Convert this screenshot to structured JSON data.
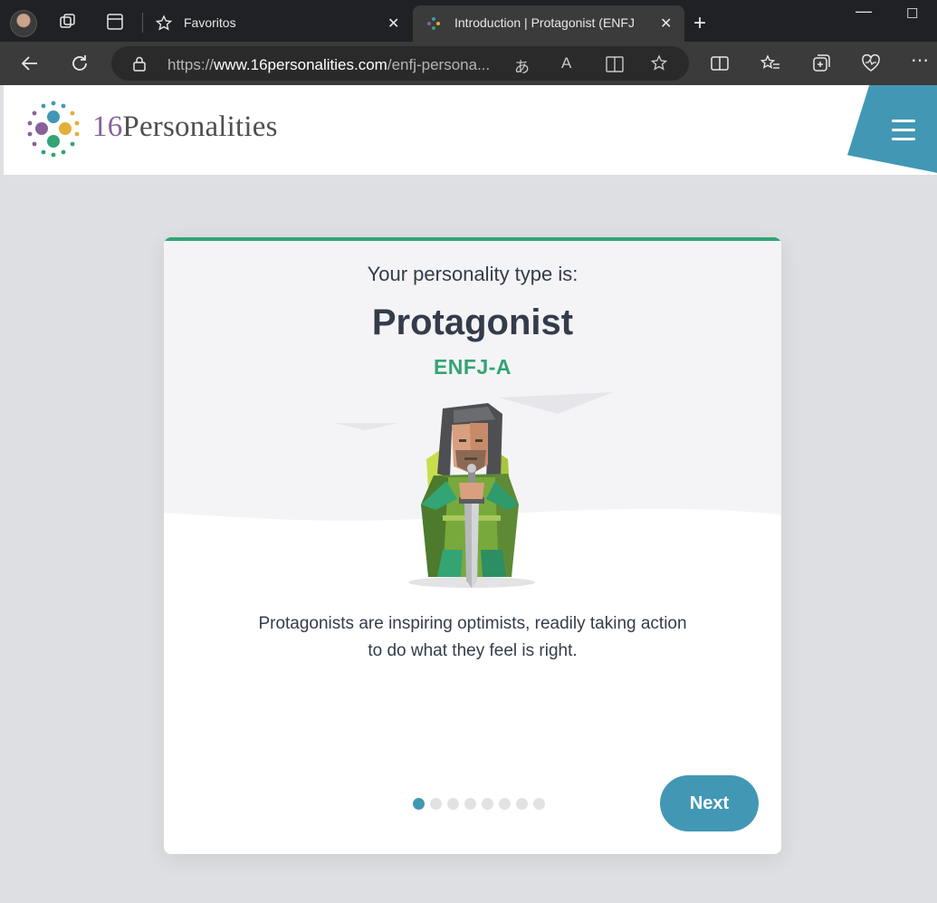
{
  "browser": {
    "tabs": [
      {
        "title": "Favoritos",
        "active": false
      },
      {
        "title": "Introduction | Protagonist (ENFJ",
        "active": true
      }
    ],
    "url_prefix": "https://",
    "url_domain": "www.16personalities.com",
    "url_path": "/enfj-persona...",
    "icons": [
      "profile-avatar",
      "workspaces-icon",
      "tab-actions-icon",
      "favorites-star-icon",
      "close-icon",
      "new-tab-icon",
      "minimize-icon",
      "maximize-icon",
      "back-icon",
      "refresh-icon",
      "lock-icon",
      "translate-icon",
      "read-aloud-icon",
      "immersive-reader-icon",
      "favorite-icon",
      "split-screen-icon",
      "favorites-icon",
      "collections-icon",
      "browser-essentials-icon",
      "more-icon"
    ]
  },
  "site": {
    "logo_number": "16",
    "logo_word": "Personalities",
    "brand_colors": {
      "purple": "#88619a",
      "blue": "#4298b4",
      "yellow": "#e4ae3a",
      "green": "#33a474"
    }
  },
  "card": {
    "intro": "Your personality type is:",
    "type_name": "Protagonist",
    "type_code": "ENFJ-A",
    "description_line1": "Protagonists are inspiring optimists, readily taking action",
    "description_line2": "to do what they feel is right.",
    "pagination": {
      "current": 1,
      "total": 8
    },
    "next_label": "Next"
  }
}
